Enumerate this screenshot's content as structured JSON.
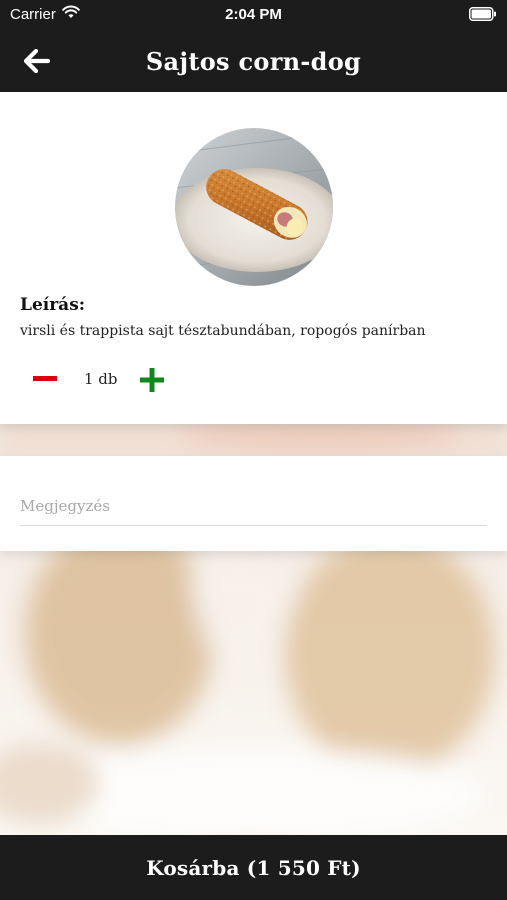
{
  "status_bar": {
    "carrier": "Carrier",
    "time": "2:04 PM",
    "wifi_icon": "wifi-icon",
    "battery_icon": "battery-icon"
  },
  "nav": {
    "back_icon": "arrow-left-icon",
    "title": "Sajtos corn-dog"
  },
  "product": {
    "image_description": "corn-dog-photo",
    "description_heading": "Leírás:",
    "description": "virsli és trappista sajt tésztabundában, ropogós panírban",
    "quantity_label": "1 db",
    "minus_icon": "minus-icon",
    "plus_icon": "plus-icon",
    "minus_color": "#e0000b",
    "plus_color": "#0f8a1a"
  },
  "note": {
    "placeholder": "Megjegyzés",
    "value": ""
  },
  "cart": {
    "button_label": "Kosárba (1 550 Ft)"
  },
  "colors": {
    "bar_background": "#1c1c1c",
    "card_background": "#ffffff"
  }
}
